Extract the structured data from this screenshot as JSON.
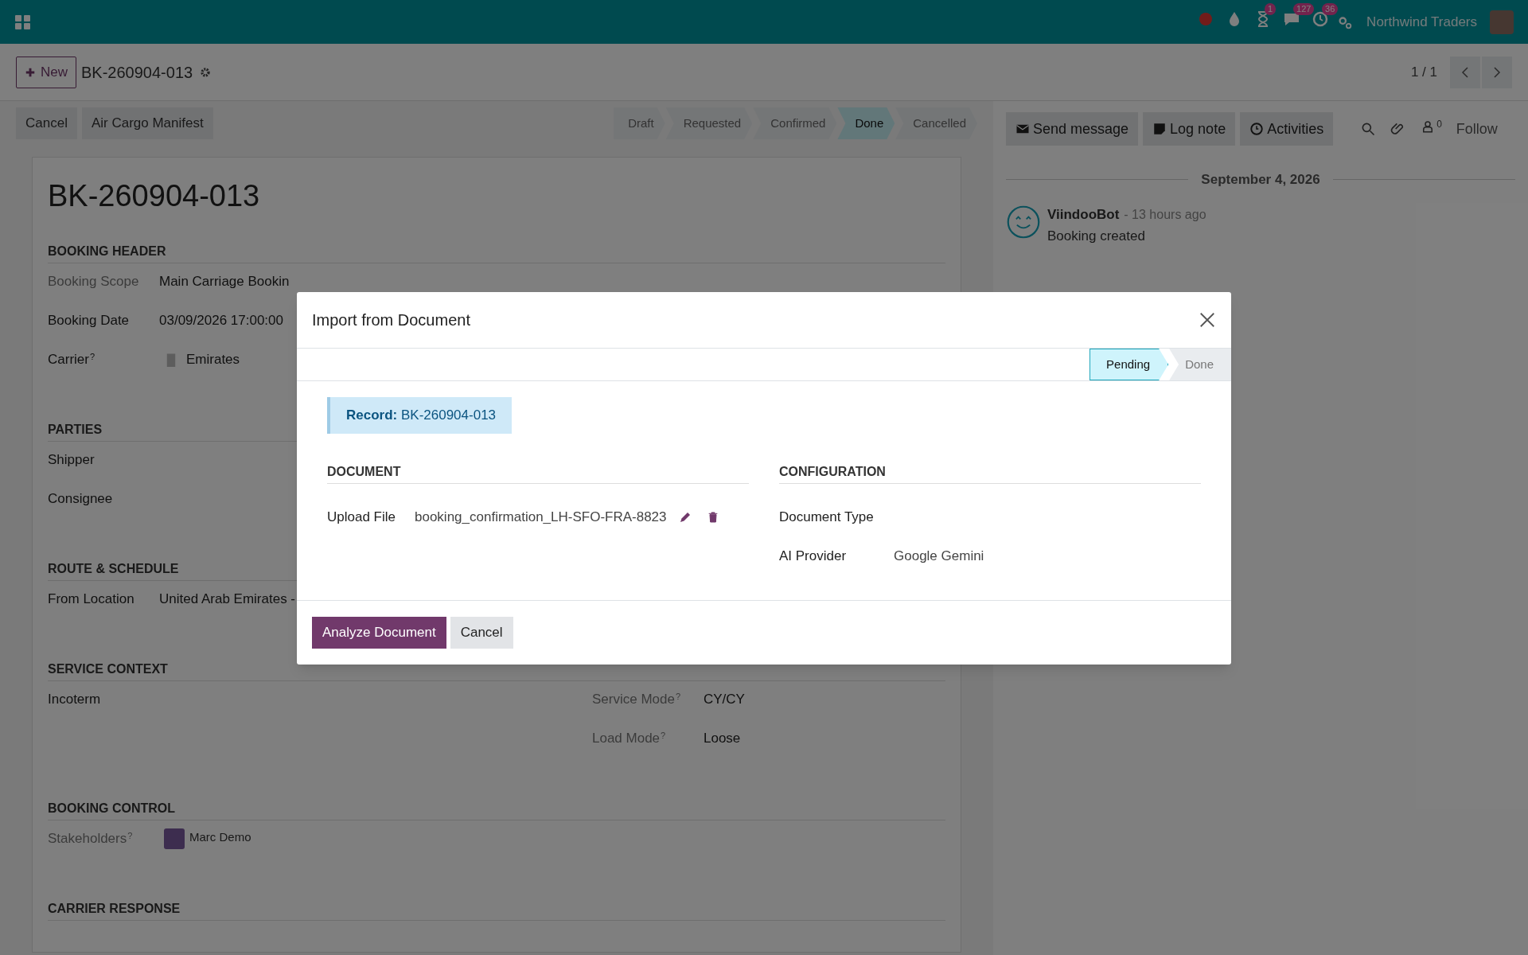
{
  "navbar": {
    "badges": [
      {
        "kind": "record"
      },
      {
        "kind": "drop"
      },
      {
        "kind": "hourglass",
        "count": "1"
      },
      {
        "kind": "chat",
        "count": "127"
      },
      {
        "kind": "clock",
        "count": "36"
      }
    ],
    "company": "Northwind Traders"
  },
  "control_panel": {
    "new_button": "New",
    "record_title": "BK-260904-013",
    "pager": "1 / 1"
  },
  "status_bar": {
    "buttons": [
      "Cancel",
      "Air Cargo Manifest"
    ],
    "stages": [
      {
        "label": "Draft",
        "selected": false
      },
      {
        "label": "Requested",
        "selected": false
      },
      {
        "label": "Confirmed",
        "selected": false
      },
      {
        "label": "Done",
        "selected": true
      },
      {
        "label": "Cancelled",
        "selected": false
      }
    ]
  },
  "form": {
    "title": "BK-260904-013",
    "sections": [
      {
        "heading": "BOOKING HEADER",
        "left": [
          {
            "kind": "text",
            "label": "Booking Scope",
            "readonly": true,
            "value": "Main Carriage Bookin"
          },
          {
            "kind": "text",
            "label": "Booking Date",
            "readonly": false,
            "value": "03/09/2026 17:00:00"
          },
          {
            "kind": "carrier",
            "label": "Carrier",
            "readonly": false,
            "help": "?",
            "value": "Emirates"
          }
        ]
      },
      {
        "heading": "PARTIES",
        "left": [
          {
            "kind": "text",
            "label": "Shipper",
            "readonly": false
          },
          {
            "kind": "text",
            "label": "Consignee",
            "readonly": false
          }
        ]
      },
      {
        "heading": "ROUTE & SCHEDULE",
        "left": [
          {
            "kind": "text",
            "label": "From Location",
            "readonly": false,
            "value": "United Arab Emirates -"
          }
        ]
      },
      {
        "heading": "SERVICE CONTEXT",
        "left": [
          {
            "kind": "text",
            "label": "Incoterm",
            "readonly": false
          }
        ],
        "right": [
          {
            "kind": "text",
            "label": "Service Mode",
            "readonly": true,
            "help": "?",
            "value": "CY/CY"
          },
          {
            "kind": "text",
            "label": "Load Mode",
            "readonly": true,
            "help": "?",
            "value": "Loose"
          }
        ]
      },
      {
        "heading": "BOOKING CONTROL",
        "left": [
          {
            "kind": "user",
            "label": "Stakeholders",
            "readonly": true,
            "help": "?",
            "value": "Marc Demo"
          }
        ]
      },
      {
        "heading": "CARRIER RESPONSE"
      }
    ]
  },
  "chatter": {
    "buttons": [
      {
        "kind": "mail",
        "label": "Send message"
      },
      {
        "kind": "note",
        "label": "Log note"
      },
      {
        "kind": "clock",
        "label": "Activities"
      }
    ],
    "follower_count": "0",
    "follow": "Follow",
    "date": "September 4, 2026",
    "messages": [
      {
        "author": "ViindooBot",
        "time": "- 13 hours ago",
        "body": "Booking created"
      }
    ]
  },
  "dialog": {
    "title": "Import from Document",
    "stages": [
      {
        "label": "Pending",
        "selected": true
      },
      {
        "label": "Done",
        "selected": false
      }
    ],
    "record_label": "Record:",
    "record_value": "BK-260904-013",
    "sections": [
      {
        "heading": "DOCUMENT",
        "fields": [
          {
            "kind": "file",
            "label": "Upload File",
            "value": "booking_confirmation_LH-SFO-FRA-8823"
          }
        ]
      },
      {
        "heading": "CONFIGURATION",
        "fields": [
          {
            "kind": "text",
            "label": "Document Type"
          },
          {
            "kind": "text",
            "label": "AI Provider",
            "value": "Google Gemini"
          }
        ]
      }
    ],
    "buttons": [
      {
        "kind": "primary",
        "label": "Analyze Document"
      },
      {
        "kind": "secondary",
        "label": "Cancel"
      }
    ]
  }
}
